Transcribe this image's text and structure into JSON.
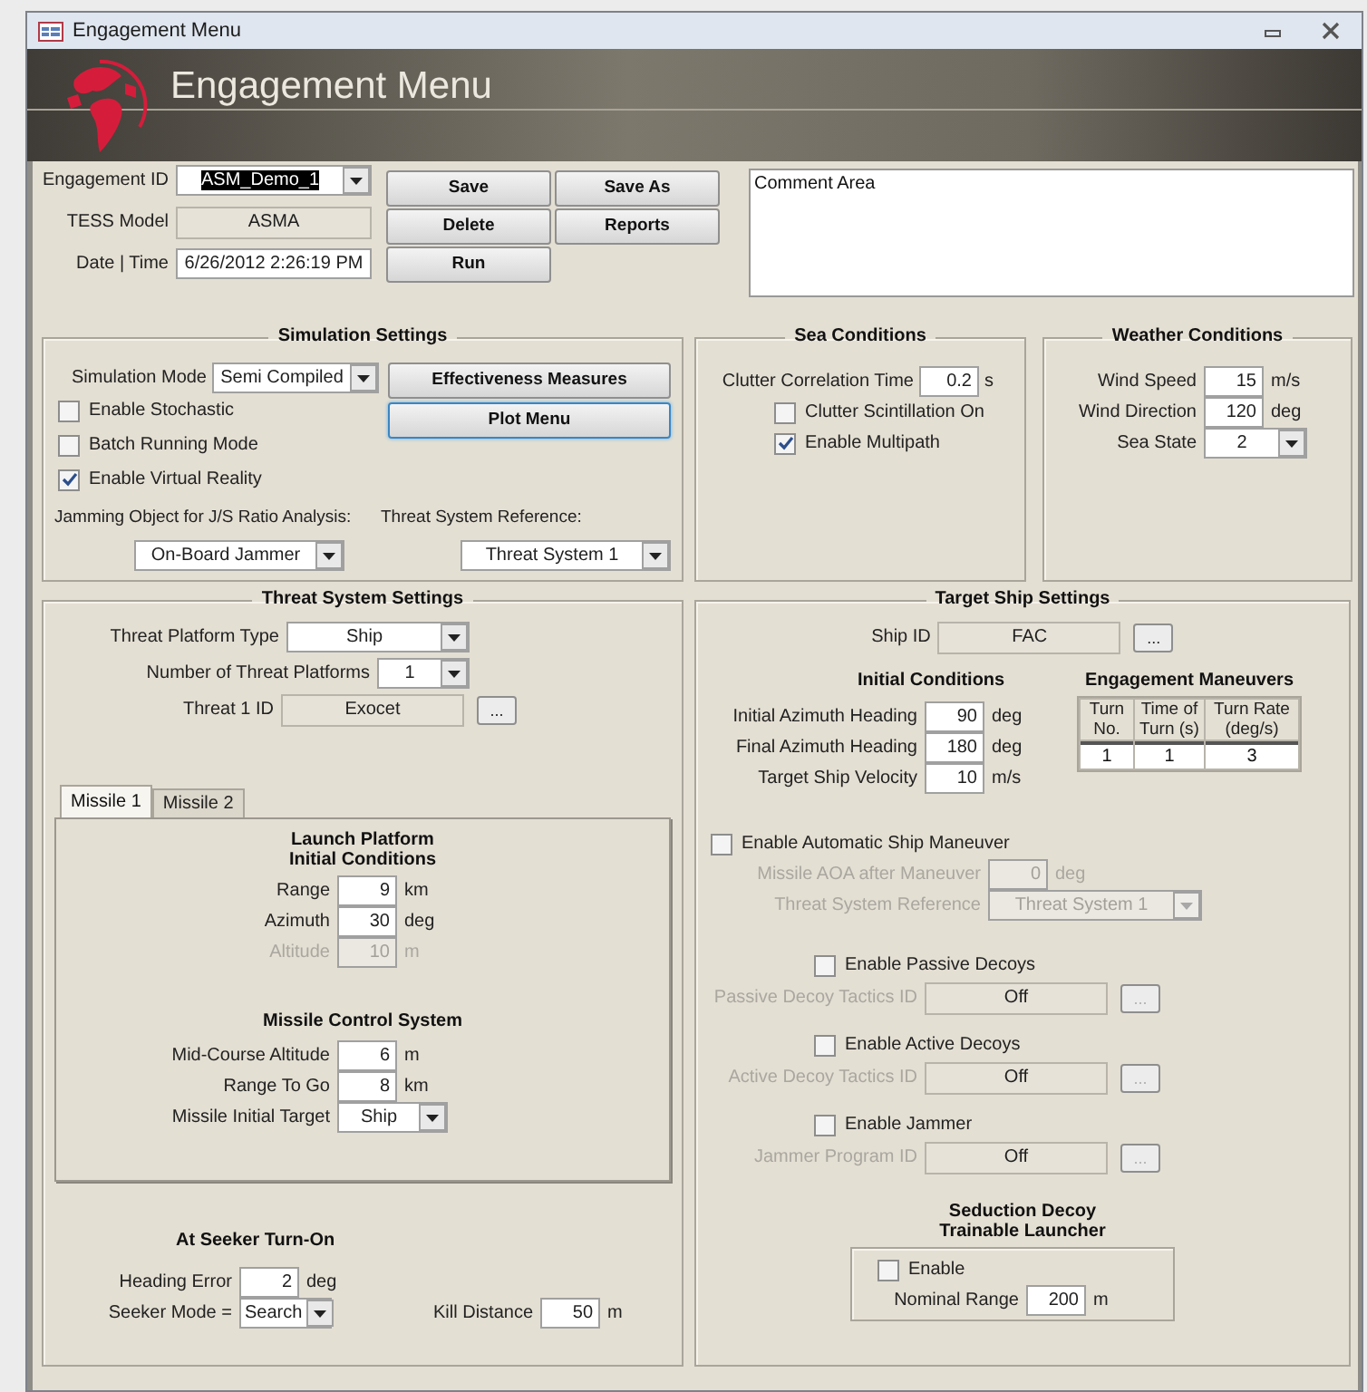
{
  "window": {
    "title": "Engagement Menu"
  },
  "header": {
    "title": "Engagement Menu"
  },
  "general": {
    "fields": [
      {
        "label": "Engagement ID",
        "kind": "combo",
        "value": "ASM_Demo_1",
        "text_selected": true
      },
      {
        "label": "TESS Model",
        "kind": "readonly",
        "value": "ASMA",
        "text_selected": false
      },
      {
        "label": "Date | Time",
        "kind": "input",
        "value": "6/26/2012 2:26:19 PM",
        "text_selected": false
      }
    ],
    "buttons": [
      "Save",
      "Save As",
      "Delete",
      "Reports",
      "Run"
    ],
    "comment": "Comment Area"
  },
  "simulation": {
    "title": "Simulation Settings",
    "mode": {
      "label": "Simulation Mode",
      "kind": "combo",
      "value": "Semi Compiled"
    },
    "options": [
      {
        "label": "Enable Stochastic",
        "checked": false
      },
      {
        "label": "Batch Running Mode",
        "checked": false
      },
      {
        "label": "Enable Virtual Reality",
        "checked": true
      }
    ],
    "buttons": [
      {
        "label": "Effectiveness Measures",
        "focused": false
      },
      {
        "label": "Plot Menu",
        "focused": true
      }
    ],
    "jamming": {
      "label": "Jamming Object for J/S Ratio Analysis:",
      "kind": "combo",
      "value": "On-Board Jammer"
    },
    "reference": {
      "label": "Threat System Reference:",
      "kind": "combo",
      "value": "Threat System 1"
    }
  },
  "sea": {
    "title": "Sea Conditions",
    "correlation": {
      "label": "Clutter Correlation Time",
      "kind": "input",
      "value": "0.2",
      "unit": "s"
    },
    "options": [
      {
        "label": "Clutter Scintillation On",
        "checked": false
      },
      {
        "label": "Enable Multipath",
        "checked": true
      }
    ]
  },
  "weather": {
    "title": "Weather Conditions",
    "fields": [
      {
        "label": "Wind Speed",
        "kind": "input",
        "value": "15",
        "unit": "m/s"
      },
      {
        "label": "Wind Direction",
        "kind": "input",
        "value": "120",
        "unit": "deg"
      },
      {
        "label": "Sea State",
        "kind": "combo",
        "value": "2"
      }
    ]
  },
  "threat": {
    "title": "Threat System Settings",
    "fields": [
      {
        "label": "Threat Platform Type",
        "kind": "combo",
        "value": "Ship"
      },
      {
        "label": "Number of Threat Platforms",
        "kind": "combo",
        "value": "1"
      },
      {
        "label": "Threat 1 ID",
        "kind": "browse",
        "value": "Exocet",
        "button": "..."
      }
    ],
    "tabs": [
      {
        "label": "Missile 1",
        "selected": true
      },
      {
        "label": "Missile 2",
        "selected": false
      }
    ],
    "launch": {
      "title_lines": [
        "Launch Platform",
        "Initial Conditions"
      ],
      "fields": [
        {
          "label": "Range",
          "kind": "input",
          "value": "9",
          "unit": "km",
          "disabled": false
        },
        {
          "label": "Azimuth",
          "kind": "input",
          "value": "30",
          "unit": "deg",
          "disabled": false
        },
        {
          "label": "Altitude",
          "kind": "input",
          "value": "10",
          "unit": "m",
          "disabled": true
        }
      ]
    },
    "control": {
      "title": "Missile Control System",
      "fields": [
        {
          "label": "Mid-Course Altitude",
          "kind": "input",
          "value": "6",
          "unit": "m"
        },
        {
          "label": "Range To Go",
          "kind": "input",
          "value": "8",
          "unit": "km"
        },
        {
          "label": "Missile Initial Target",
          "kind": "combo",
          "value": "Ship"
        }
      ]
    },
    "seeker": {
      "title": "At Seeker Turn-On",
      "fields": [
        {
          "label": "Heading Error",
          "kind": "input",
          "value": "2",
          "unit": "deg"
        },
        {
          "label": "Seeker Mode =",
          "kind": "combo",
          "value": "Search"
        }
      ],
      "kill": {
        "label": "Kill Distance",
        "kind": "input",
        "value": "50",
        "unit": "m"
      }
    }
  },
  "target": {
    "title": "Target Ship Settings",
    "ship": {
      "label": "Ship ID",
      "kind": "browse",
      "value": "FAC",
      "button": "..."
    },
    "initial": {
      "title": "Initial Conditions",
      "fields": [
        {
          "label": "Initial Azimuth Heading",
          "kind": "input",
          "value": "90",
          "unit": "deg"
        },
        {
          "label": "Final Azimuth Heading",
          "kind": "input",
          "value": "180",
          "unit": "deg"
        },
        {
          "label": "Target Ship Velocity",
          "kind": "input",
          "value": "10",
          "unit": "m/s"
        }
      ]
    },
    "maneuvers": {
      "title": "Engagement Maneuvers",
      "columns": [
        "Turn No.",
        "Time of Turn (s)",
        "Turn Rate (deg/s)"
      ],
      "rows": [
        [
          "1",
          "1",
          "3"
        ]
      ]
    },
    "auto": {
      "label": "Enable Automatic Ship Maneuver",
      "checked": false,
      "fields": [
        {
          "label": "Missile AOA after Maneuver",
          "kind": "input",
          "value": "0",
          "unit": "deg",
          "disabled": true
        },
        {
          "label": "Threat System Reference",
          "kind": "combo",
          "value": "Threat System 1",
          "disabled": true
        }
      ]
    },
    "decoys": [
      {
        "label": "Enable Passive Decoys",
        "checked": false,
        "field": {
          "label": "Passive Decoy Tactics ID",
          "kind": "browse",
          "value": "Off",
          "button": "...",
          "disabled": true
        }
      },
      {
        "label": "Enable Active Decoys",
        "checked": false,
        "field": {
          "label": "Active Decoy Tactics ID",
          "kind": "browse",
          "value": "Off",
          "button": "...",
          "disabled": true
        }
      },
      {
        "label": "Enable Jammer",
        "checked": false,
        "field": {
          "label": "Jammer Program ID",
          "kind": "browse",
          "value": "Off",
          "button": "...",
          "disabled": true
        }
      }
    ],
    "seduction": {
      "title_lines": [
        "Seduction Decoy",
        "Trainable Launcher"
      ],
      "enable": {
        "label": "Enable",
        "checked": false
      },
      "range": {
        "label": "Nominal Range",
        "kind": "input",
        "value": "200",
        "unit": "m"
      }
    }
  }
}
